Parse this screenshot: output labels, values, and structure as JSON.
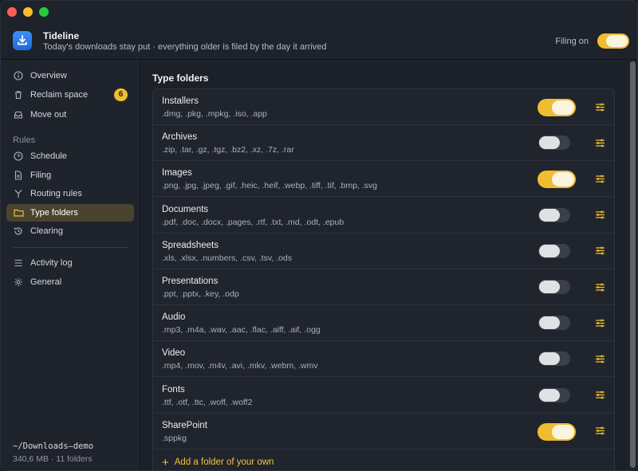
{
  "header": {
    "app_name": "Tideline",
    "subtitle": "Today's downloads stay put · everything older is filed by the day it arrived",
    "filing_label": "Filing on",
    "filing_on": true
  },
  "sidebar": {
    "items": [
      {
        "label": "Overview",
        "icon": "info-icon"
      },
      {
        "label": "Reclaim space",
        "icon": "trash-icon",
        "badge": "6"
      },
      {
        "label": "Move out",
        "icon": "tray-icon"
      }
    ],
    "rules_heading": "Rules",
    "rules": [
      {
        "label": "Schedule",
        "icon": "clock-icon"
      },
      {
        "label": "Filing",
        "icon": "document-icon"
      },
      {
        "label": "Routing rules",
        "icon": "branch-icon"
      },
      {
        "label": "Type folders",
        "icon": "folder-icon",
        "active": true
      },
      {
        "label": "Clearing",
        "icon": "history-icon"
      }
    ],
    "footer_items": [
      {
        "label": "Activity log",
        "icon": "list-icon"
      },
      {
        "label": "General",
        "icon": "gear-icon"
      }
    ],
    "path": "~/Downloads—demo",
    "size": "340,6 MB · 11 folders"
  },
  "main": {
    "section_title": "Type folders",
    "folders": [
      {
        "name": "Installers",
        "exts": ".dmg, .pkg, .mpkg, .iso, .app",
        "on": true
      },
      {
        "name": "Archives",
        "exts": ".zip, .tar, .gz, .tgz, .bz2, .xz, .7z, .rar",
        "on": false
      },
      {
        "name": "Images",
        "exts": ".png, .jpg, .jpeg, .gif, .heic, .heif, .webp, .tiff, .tif, .bmp, .svg",
        "on": true
      },
      {
        "name": "Documents",
        "exts": ".pdf, .doc, .docx, .pages, .rtf, .txt, .md, .odt, .epub",
        "on": false
      },
      {
        "name": "Spreadsheets",
        "exts": ".xls, .xlsx, .numbers, .csv, .tsv, .ods",
        "on": false
      },
      {
        "name": "Presentations",
        "exts": ".ppt, .pptx, .key, .odp",
        "on": false
      },
      {
        "name": "Audio",
        "exts": ".mp3, .m4a, .wav, .aac, .flac, .aiff, .aif, .ogg",
        "on": false
      },
      {
        "name": "Video",
        "exts": ".mp4, .mov, .m4v, .avi, .mkv, .webm, .wmv",
        "on": false
      },
      {
        "name": "Fonts",
        "exts": ".ttf, .otf, .ttc, .woff, .woff2",
        "on": false
      },
      {
        "name": "SharePoint",
        "exts": ".sppkg",
        "on": true
      }
    ],
    "add_folder_label": "Add a folder of your own"
  },
  "colors": {
    "accent": "#f0bd32",
    "active_nav_bg": "#4a4330",
    "window_bg": "#1d212a"
  }
}
